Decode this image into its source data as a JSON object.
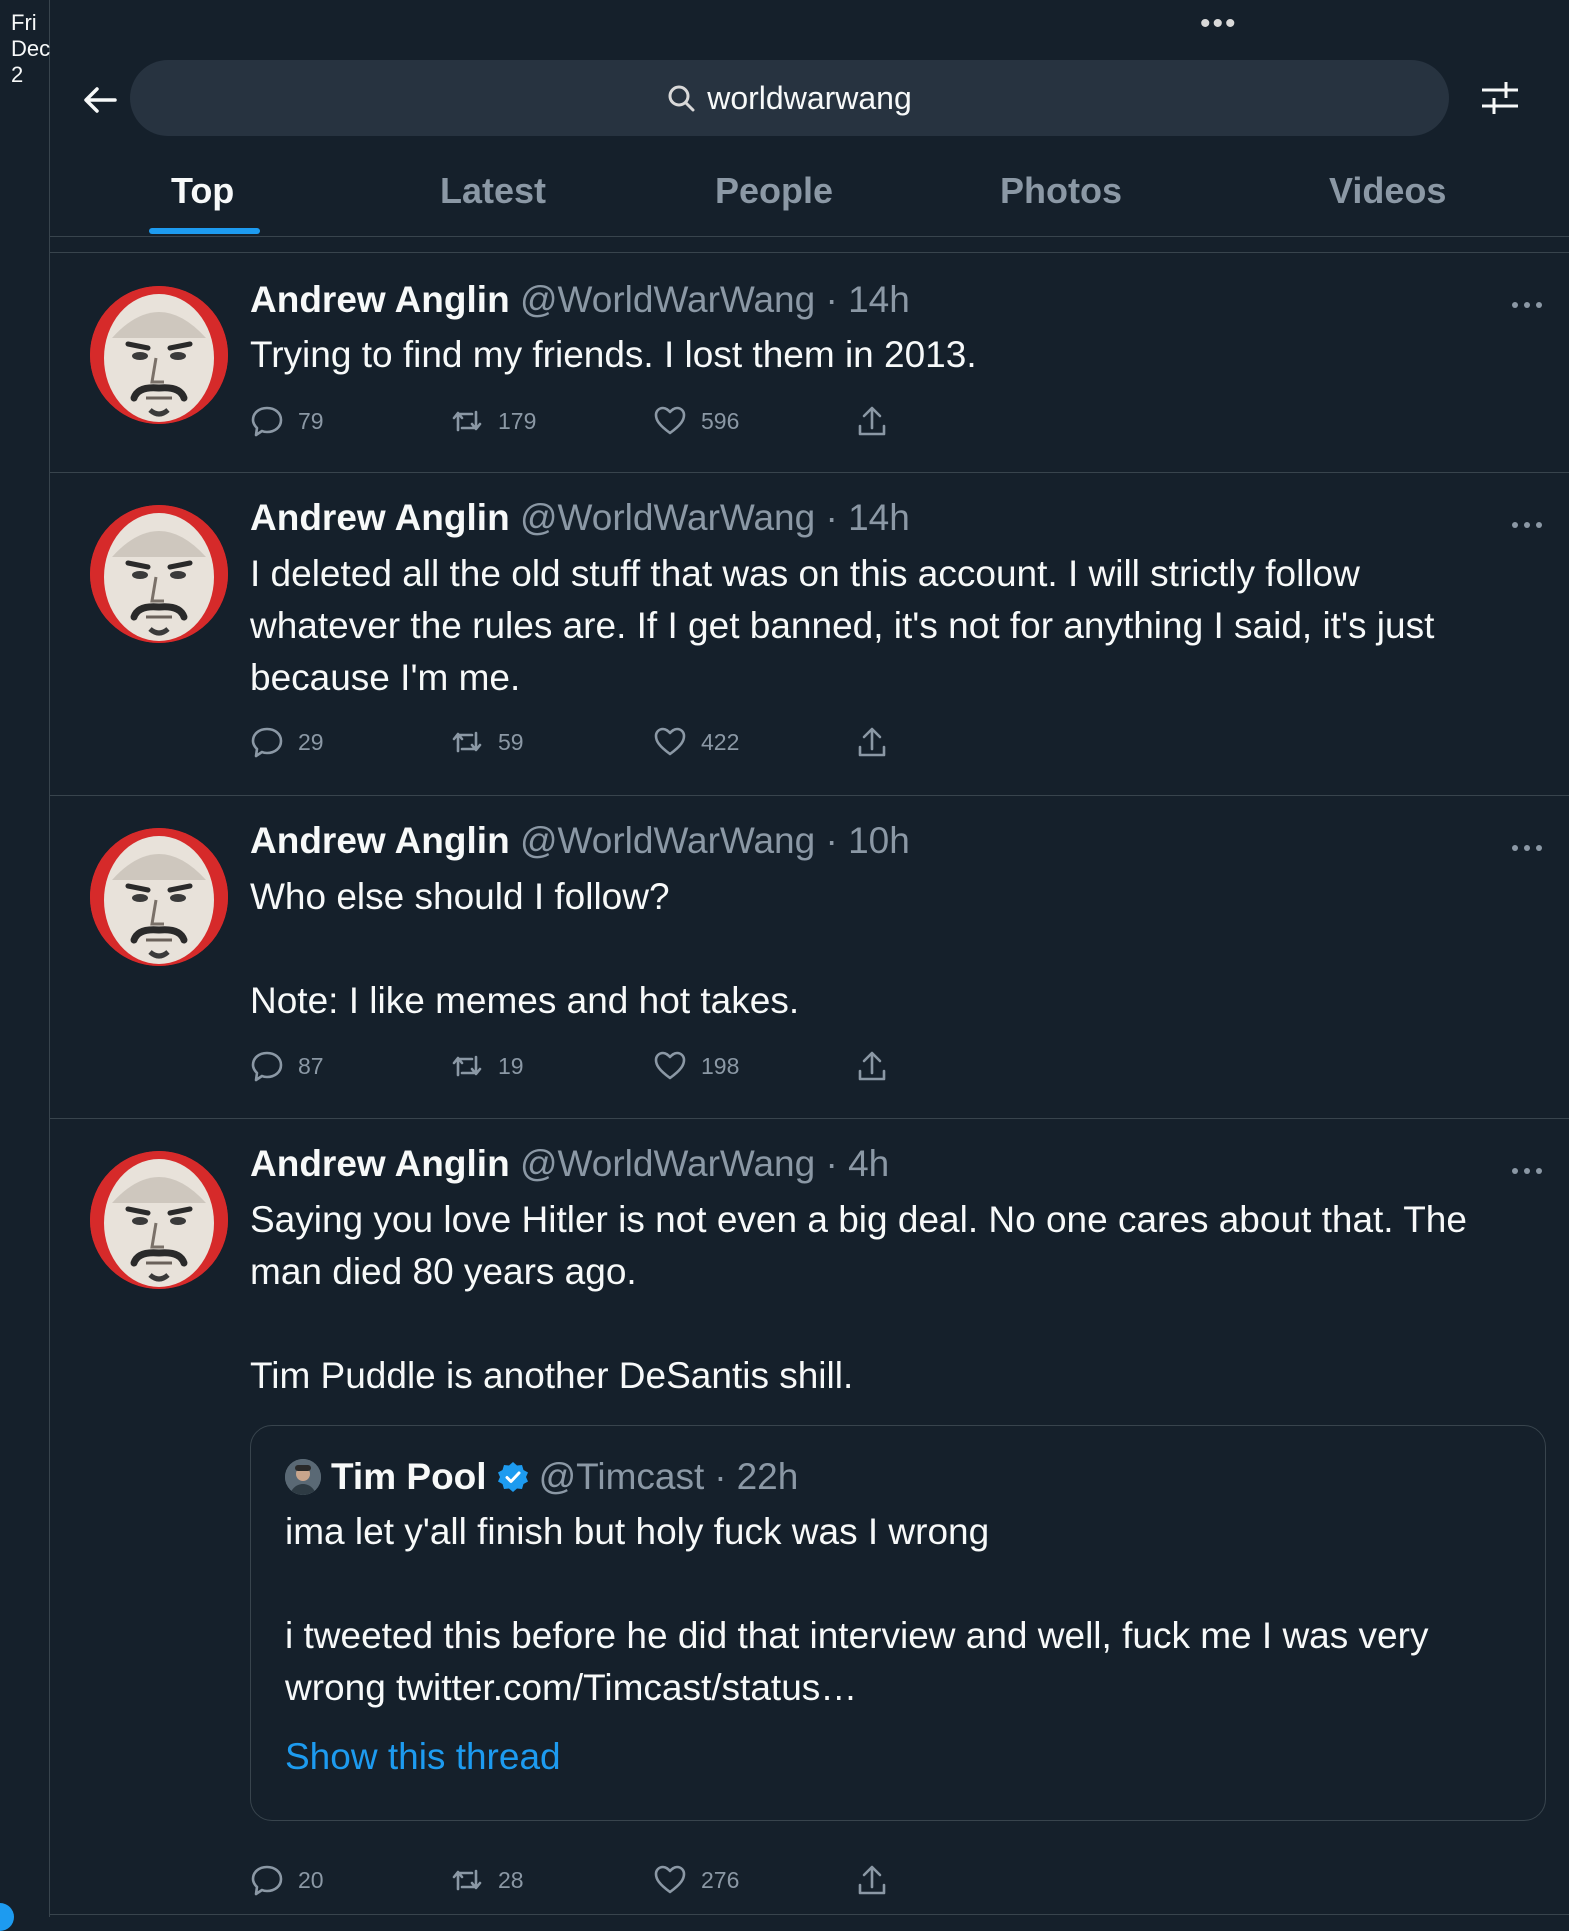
{
  "status_bar": {
    "time": "Fri Dec 2"
  },
  "search": {
    "query": "worldwarwang"
  },
  "tabs": [
    {
      "label": "Top",
      "active": true
    },
    {
      "label": "Latest",
      "active": false
    },
    {
      "label": "People",
      "active": false
    },
    {
      "label": "Photos",
      "active": false
    },
    {
      "label": "Videos",
      "active": false
    }
  ],
  "tweets": [
    {
      "name": "Andrew Anglin",
      "handle": "@WorldWarWang",
      "time": "14h",
      "text": "Trying to find my friends. I lost them in 2013.",
      "replies": "79",
      "retweets": "179",
      "likes": "596"
    },
    {
      "name": "Andrew Anglin",
      "handle": "@WorldWarWang",
      "time": "14h",
      "text": "I deleted all the old stuff that was on this account. I will strictly follow whatever the rules are. If I get banned, it's not for anything I said, it's just because I'm me.",
      "replies": "29",
      "retweets": "59",
      "likes": "422"
    },
    {
      "name": "Andrew Anglin",
      "handle": "@WorldWarWang",
      "time": "10h",
      "text": "Who else should I follow?\n\nNote: I like memes and hot takes.",
      "replies": "87",
      "retweets": "19",
      "likes": "198"
    },
    {
      "name": "Andrew Anglin",
      "handle": "@WorldWarWang",
      "time": "4h",
      "text": "Saying you love Hitler is not even a big deal. No one cares about that. The man died 80 years ago.\n\nTim Puddle is another DeSantis shill.",
      "replies": "20",
      "retweets": "28",
      "likes": "276",
      "quote": {
        "name": "Tim Pool",
        "handle": "@Timcast",
        "time": "22h",
        "verified": true,
        "text": "ima let y'all finish but holy fuck was I wrong\n\ni tweeted this before he did that interview and well, fuck me I was very wrong twitter.com/Timcast/status…",
        "link": "Show this thread"
      }
    }
  ],
  "colors": {
    "accent": "#1d9bf0",
    "background": "#15202b",
    "muted": "#8b98a5",
    "avatar_ring": "#d62a2a"
  },
  "icons": [
    "back-arrow-icon",
    "search-icon",
    "filter-sliders-icon",
    "more-icon",
    "reply-icon",
    "retweet-icon",
    "like-icon",
    "share-icon",
    "verified-badge-icon"
  ]
}
